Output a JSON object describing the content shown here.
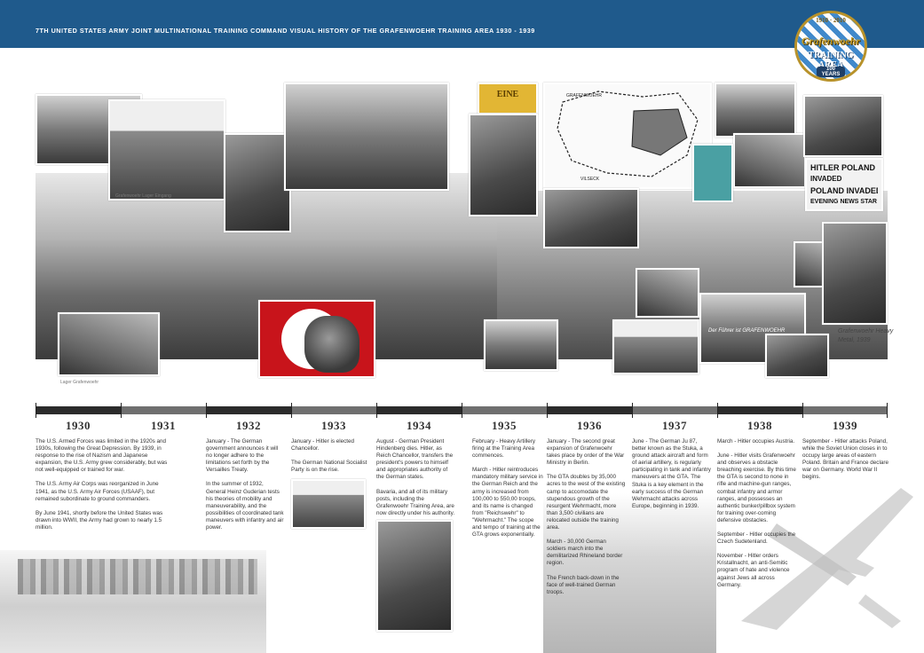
{
  "header": {
    "title": "7TH UNITED STATES ARMY JOINT MULTINATIONAL TRAINING COMMAND VISUAL HISTORY OF THE GRAFENWOEHR TRAINING AREA 1930 - 1939"
  },
  "badge": {
    "years": "1910 · 2010",
    "name": "Grafenwoehr",
    "sub": "TRAINING AREA",
    "centennial": "100 YEARS"
  },
  "images": {
    "ration_note": "EINE",
    "newspaper_lines": [
      "HITLER POLAND",
      "INVADED",
      "POLAND INVADED",
      "EVENING NEWS STAR"
    ],
    "caption_right": "Grafenwoehr Heavy Metal, 1939",
    "caption_small_1": "Grafenwoehr Lager Eingang",
    "caption_small_2": "Lager Grafenwoehr",
    "map_labels": [
      "GRAFENWOEHR",
      "VILSECK"
    ],
    "truck_sign": "Der Führer ist GRAFENWOEHR"
  },
  "timeline": {
    "years": [
      "1930",
      "1931",
      "1932",
      "1933",
      "1934",
      "1935",
      "1936",
      "1937",
      "1938",
      "1939"
    ],
    "colors": [
      "#2b2b2b",
      "#6f6f6f",
      "#2b2b2b",
      "#6f6f6f",
      "#2b2b2b",
      "#6f6f6f",
      "#2b2b2b",
      "#6f6f6f",
      "#2b2b2b",
      "#6f6f6f"
    ]
  },
  "entries": {
    "c1930": [
      "The U.S. Armed Forces was limited in the 1920s and 1930s, following the Great Depression.  By 1939, in response to the rise of Nazism and Japanese expansion, the U.S. Army grew considerably, but was not well-equipped or trained for war.",
      "The U.S. Army Air Corps was reorganized in June 1941, as the U.S. Army Air Forces (USAAF), but remained subordinate to ground commanders.",
      "By June 1941, shortly before the United States was drawn into WWII, the Army had grown to nearly 1.5 million."
    ],
    "c1932": [
      "January - The German government announces it will no longer adhere to the limitations set forth by the Versailles Treaty.",
      "In the summer of 1932, General Heinz Guderian tests his theories of mobility and maneuverability, and the possibilities of coordinated tank maneuvers with infantry and air power."
    ],
    "c1933": [
      "January - Hitler is elected Chancellor.",
      "The German National Socialist Party is on the rise."
    ],
    "c1934": [
      "August - German President Hindenberg dies. Hitler, as Reich Chancellor, transfers the president's powers to himself and appropriates authority of the German states.",
      "Bavaria, and all of its military posts, including the Grafenwoehr Training Area, are now directly under his authority."
    ],
    "c1935": [
      "February - Heavy Artillery firing at the Training Area commences.",
      "March - Hitler reintroduces mandatory military service in the German Reich and the army is increased from 100,000 to 550,00 troops, and its name is changed from \"Reichswehr\" to \"Wehrmacht.\" The scope and tempo of training at the GTA grows exponentially."
    ],
    "c1936": [
      "January - The second great expansion of Grafenwoehr takes place by order of the War Ministry in Berlin.",
      "The GTA doubles by 35,000 acres to the west of the existing camp to accomodate the stupendous growth of the resurgent Wehrmacht, more than 3,500 civilians are relocated outside the training area.",
      "March - 30,000 German soldiers march into the demilitarized Rhineland border region.",
      "The French back-down in the face of well-trained German troops."
    ],
    "c1937": [
      "June - The German Ju 87, better known as the Stuka, a ground attack aircraft and form of aerial artillery, is regularly participating in tank and infantry maneuvers at the GTA.  The Stuka is a key element in the early success of the German Wehrmacht attacks across Europe, beginning in 1939."
    ],
    "c1938": [
      "March - Hitler occupies Austria.",
      "June - Hitler visits Grafenwoehr and observes a obstacle breaching exercise.  By this time the GTA is second to none in rifle and machine-gun ranges, combat infantry and armor ranges, and possesses an authentic bunker/pillbox system for training over-coming defensive obstacles.",
      "September - Hitler occupies the Czech Sudetenland.",
      "November - Hitler orders Kristallnacht, an anti-Semitic program of hate and violence against Jews  all across Germany."
    ],
    "c1939": [
      "September - Hitler attacks Poland, while the Soviet Union closes in to occupy large areas of eastern Poland. Britain and France declare war on Germany. World War II begins."
    ]
  }
}
